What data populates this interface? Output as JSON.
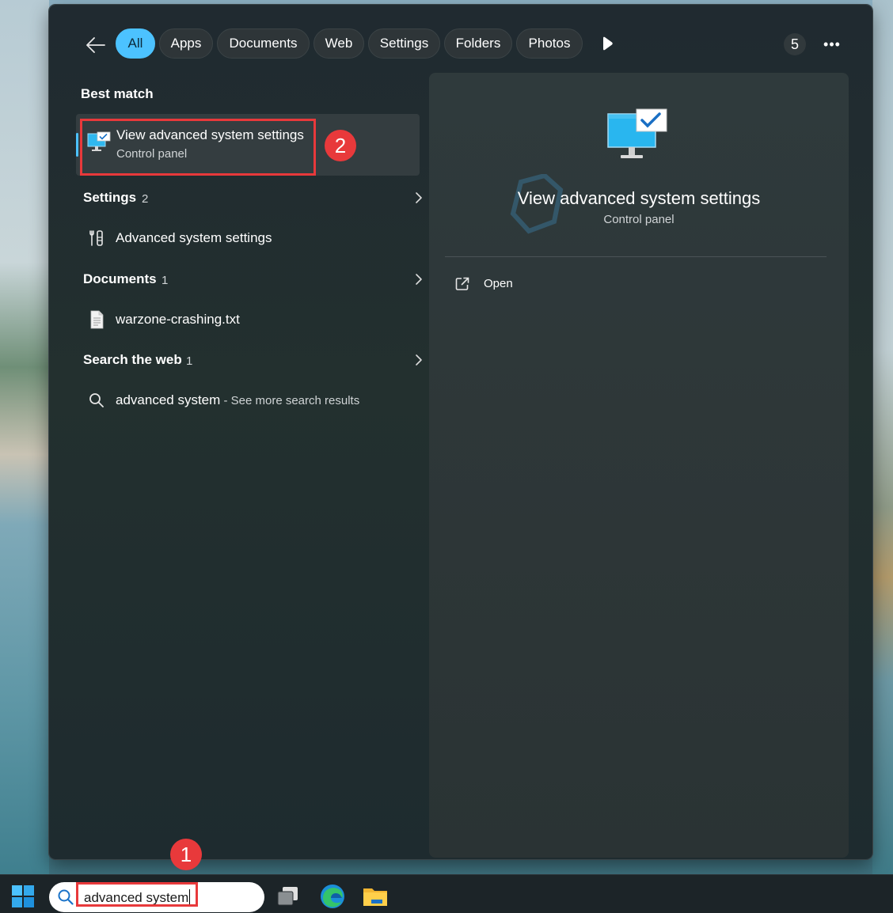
{
  "filters": {
    "back_label": "Back",
    "tabs": [
      {
        "label": "All",
        "active": true
      },
      {
        "label": "Apps"
      },
      {
        "label": "Documents"
      },
      {
        "label": "Web"
      },
      {
        "label": "Settings"
      },
      {
        "label": "Folders"
      },
      {
        "label": "Photos"
      }
    ],
    "rewards_count": "5",
    "more_label": "•••"
  },
  "results": {
    "best_match_heading": "Best match",
    "best_match": {
      "title": "View advanced system settings",
      "subtitle": "Control panel"
    },
    "settings_section": {
      "title": "Settings",
      "count": "2"
    },
    "settings_item": "Advanced system settings",
    "documents_section": {
      "title": "Documents",
      "count": "1"
    },
    "document_item": "warzone-crashing.txt",
    "web_section": {
      "title": "Search the web",
      "count": "1"
    },
    "web_item": {
      "query": "advanced system",
      "suffix": " - See more search results"
    }
  },
  "preview": {
    "title": "View advanced system settings",
    "subtitle": "Control panel",
    "action_open": "Open"
  },
  "annotations": {
    "step_1": "1",
    "step_2": "2"
  },
  "taskbar": {
    "search_value": "advanced system"
  },
  "colors": {
    "accent": "#4cc2ff",
    "annotation_red": "#e8393b",
    "panel_bg": "#202a30"
  },
  "icons": [
    "back-arrow-icon",
    "play-icon",
    "more-icon",
    "monitor-check-icon",
    "settings-tools-icon",
    "document-icon",
    "search-icon",
    "chevron-right-icon",
    "open-external-icon",
    "windows-start-icon",
    "task-view-icon",
    "edge-icon",
    "file-explorer-icon"
  ]
}
